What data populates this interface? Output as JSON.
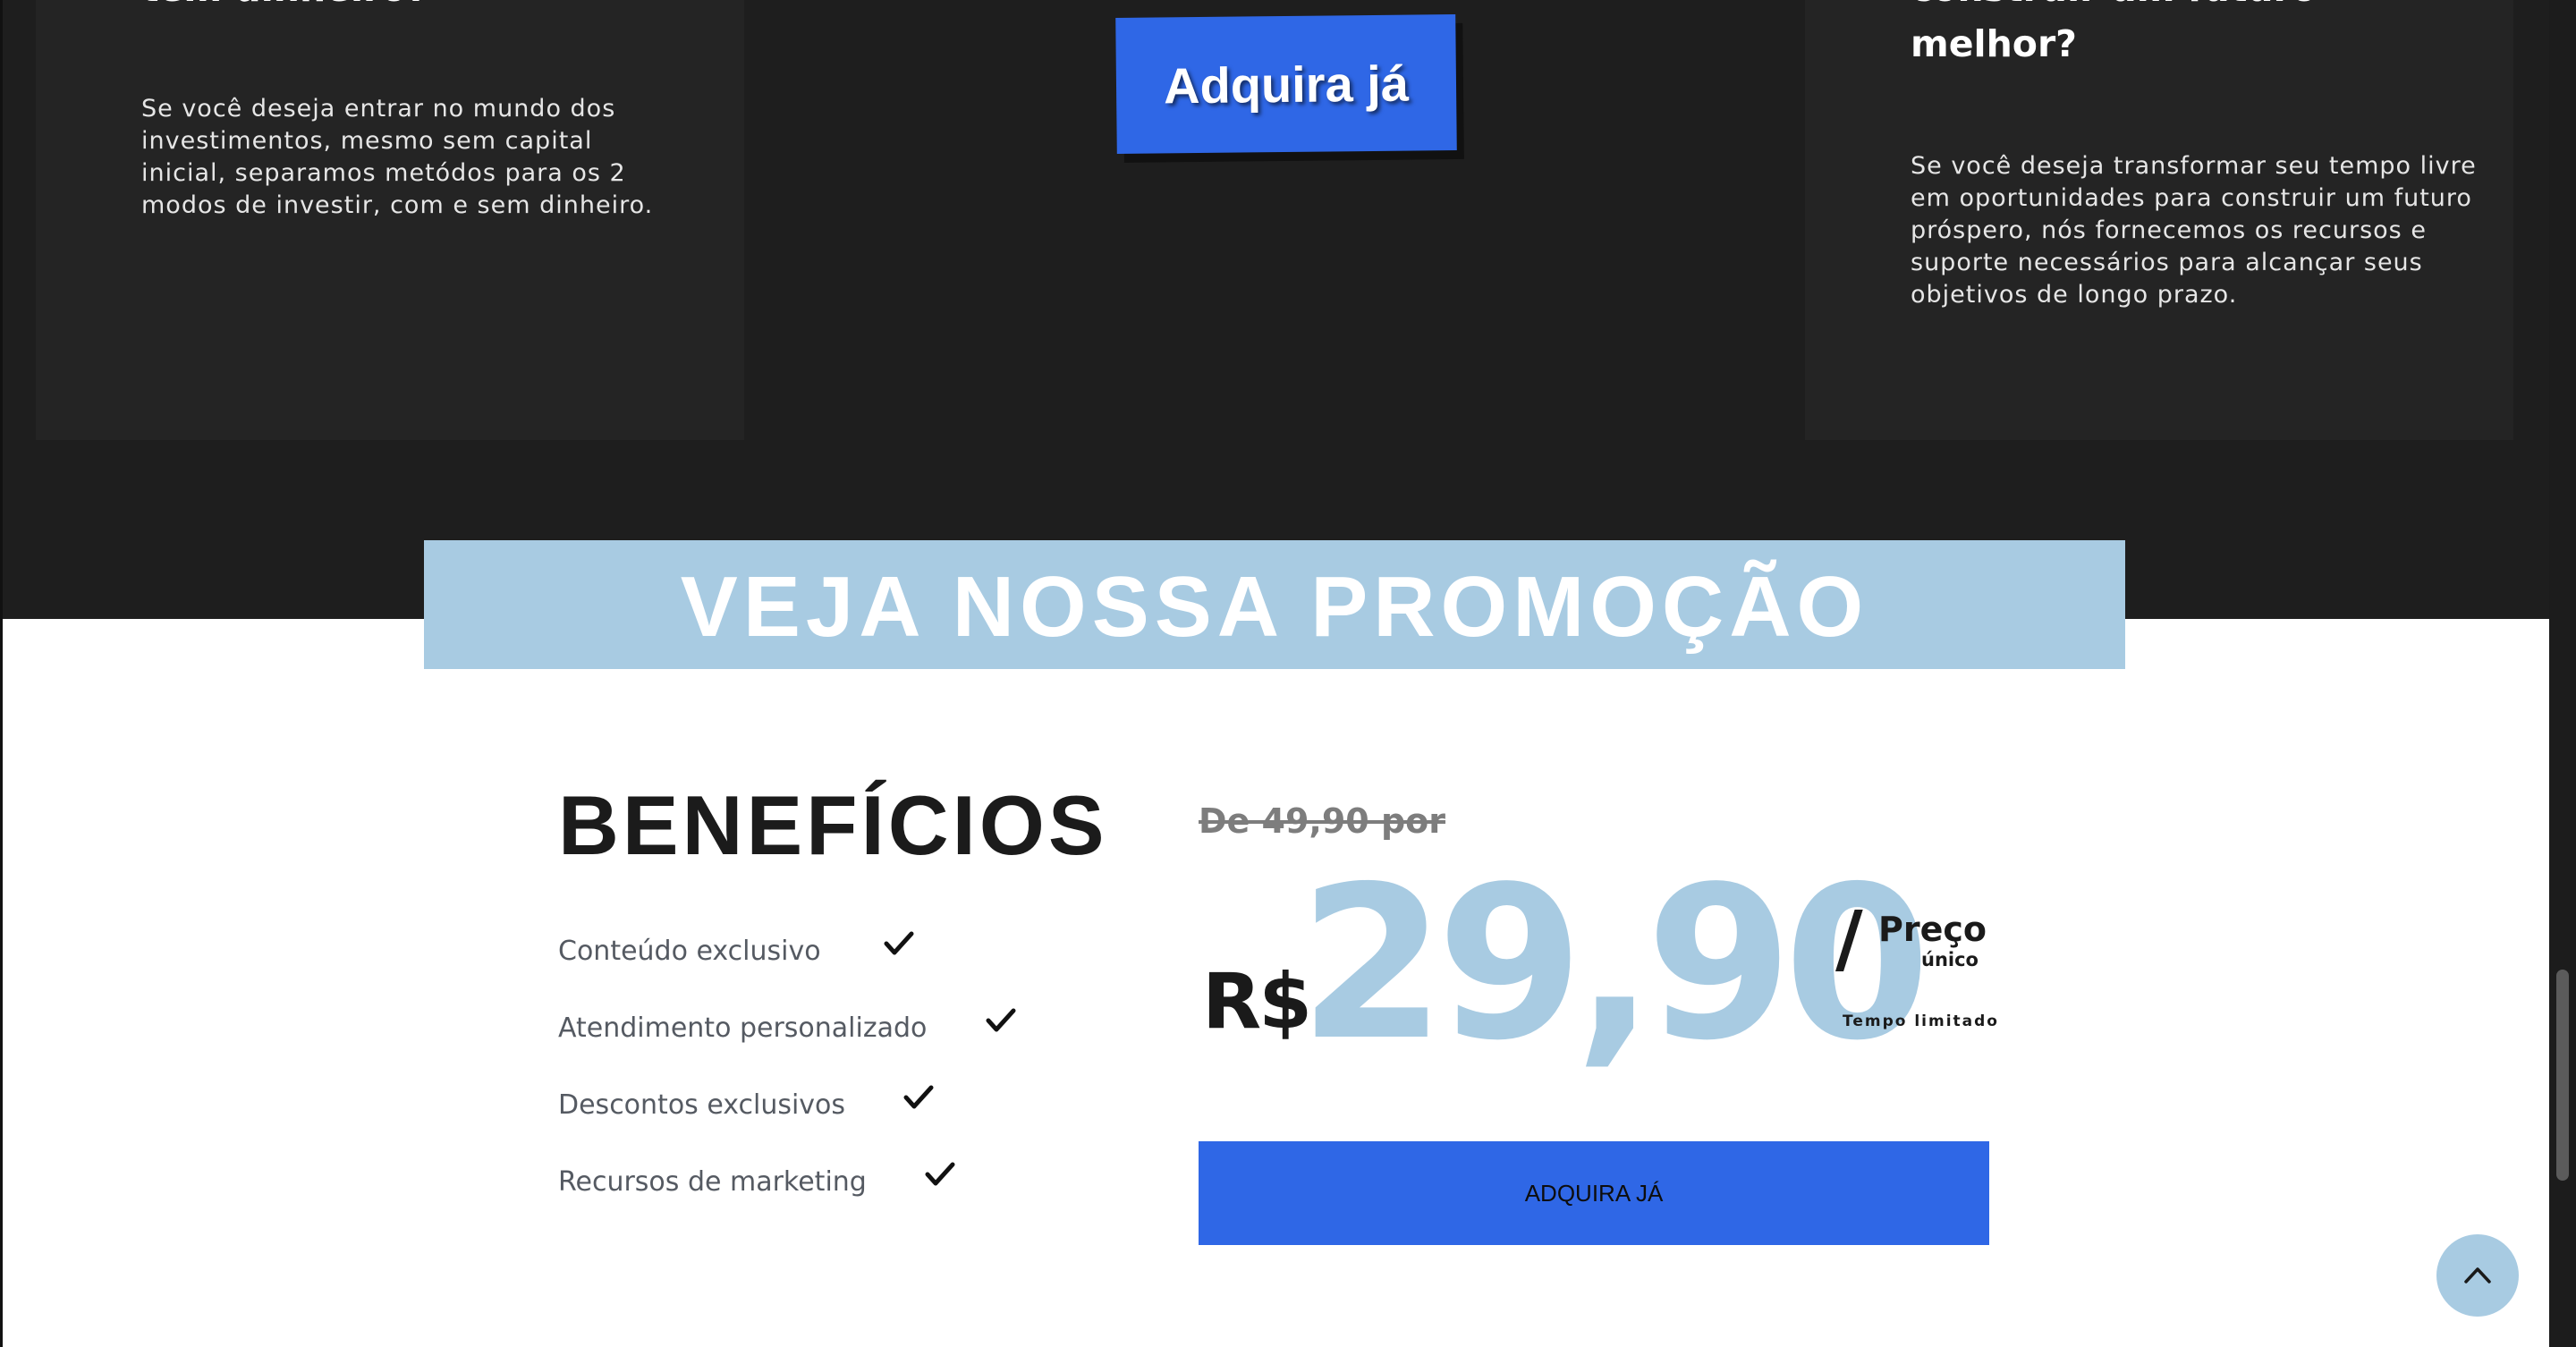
{
  "features": {
    "left_card": {
      "heading": "tem dinheiro?",
      "text": "Se você deseja entrar no mundo dos investimentos, mesmo sem capital inicial, separamos metódos para os 2 modos de investir, com e sem dinheiro."
    },
    "center_button_label": "Adquira já",
    "right_card": {
      "heading_line1": "construir um futuro",
      "heading_line2": "melhor?",
      "text": "Se você deseja transformar seu tempo livre em oportunidades para construir um futuro próspero, nós fornecemos os recursos e suporte necessários para alcançar seus objetivos de longo prazo."
    }
  },
  "promo": {
    "banner_text": "VEJA NOSSA PROMOÇÃO"
  },
  "benefits": {
    "title": "BENEFÍCIOS",
    "items": [
      {
        "label": "Conteúdo exclusivo",
        "icon": "check-icon"
      },
      {
        "label": "Atendimento personalizado",
        "icon": "check-icon"
      },
      {
        "label": "Descontos exclusivos",
        "icon": "check-icon"
      },
      {
        "label": "Recursos de marketing",
        "icon": "check-icon"
      }
    ]
  },
  "pricing": {
    "old_price": "De 49,90 por",
    "currency": "R$",
    "price": "29,90",
    "slash": "/",
    "unit_label": "Preço",
    "unit_sublabel": "único",
    "limited_label": "Tempo limitado",
    "cta_label": "ADQUIRA JÁ"
  },
  "back_to_top": {
    "icon": "chevron-up-icon"
  },
  "colors": {
    "dark_bg": "#1e1e1e",
    "card_bg": "#242424",
    "accent_blue": "#2f67e6",
    "light_blue": "#a8cbe2"
  }
}
